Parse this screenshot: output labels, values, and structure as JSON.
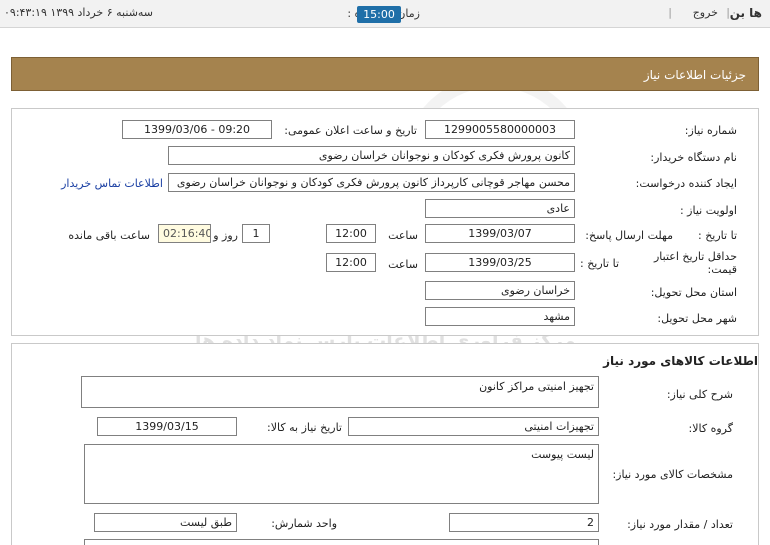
{
  "topbar": {
    "brand": "ها بن",
    "exit": "خروج",
    "remaining_label": "زمان باقیمانده :",
    "remaining_time": "15:00",
    "datetime": "سه‌شنبه ۶ خرداد ۱۳۹۹  ۰۹:۴۳:۱۹"
  },
  "panel_title": "جزئیات اطلاعات نیاز",
  "form": {
    "need_number_label": "شماره نیاز:",
    "need_number": "1299005580000003",
    "announce_label": "تاریخ و ساعت اعلان عمومی:",
    "announce_value": "1399/03/06 - 09:20",
    "buyer_label": "نام دستگاه خریدار:",
    "buyer_value": "کانون پرورش فکری کودکان و نوجوانان خراسان رضوی",
    "creator_label": "ایجاد کننده درخواست:",
    "creator_value": "محسن مهاجر قوچانی کارپرداز کانون پرورش فکری کودکان و نوجوانان خراسان رضوی",
    "contact_link": "اطلاعات تماس خریدار",
    "priority_label": "اولویت نیاز :",
    "priority_value": "عادی",
    "deadline_label": "مهلت ارسال پاسخ:",
    "to_date_label": "تا تاریخ :",
    "deadline_date": "1399/03/07",
    "hour_label": "ساعت",
    "deadline_time": "12:00",
    "days_value": "1",
    "days_label": "روز و",
    "remaining_value": "02:16:40",
    "remaining_label": "ساعت باقی مانده",
    "validity_label": "حداقل تاریخ اعتبار قیمت:",
    "validity_to_label": "تا تاریخ :",
    "validity_date": "1399/03/25",
    "validity_hour_label": "ساعت",
    "validity_time": "12:00",
    "province_label": "استان محل تحویل:",
    "province_value": "خراسان رضوی",
    "city_label": "شهر محل تحویل:",
    "city_value": "مشهد"
  },
  "goods": {
    "section_title": "اطلاعات کالاهای مورد نیاز",
    "desc_label": "شرح کلی نیاز:",
    "desc_value": "تجهیز امنیتی مراکز کانون",
    "group_label": "گروه کالا:",
    "group_value": "تجهیزات امنیتی",
    "need_date_label": "تاریخ نیاز به کالا:",
    "need_date_value": "1399/03/15",
    "spec_label": "مشخصات کالای مورد نیاز:",
    "spec_value": "لیست پیوست",
    "qty_label": "تعداد / مقدار مورد نیاز:",
    "qty_value": "2",
    "unit_label": "واحد شمارش:",
    "unit_value": "طبق لیست"
  },
  "watermark": {
    "line1": "ParsNamadData",
    "line2": "مرکز فراوری اطلاعات پارس نماد داده ها",
    "line3": "سامانه اطلاع رسانی مناقصه ومزایده",
    "line4": "۰۲۱-۸۸۳۴۹۶۷۰-۵"
  },
  "colors": {
    "header_bg": "#a5834e",
    "clock_bg": "#1f6fa8",
    "link": "#1a3fa3"
  }
}
